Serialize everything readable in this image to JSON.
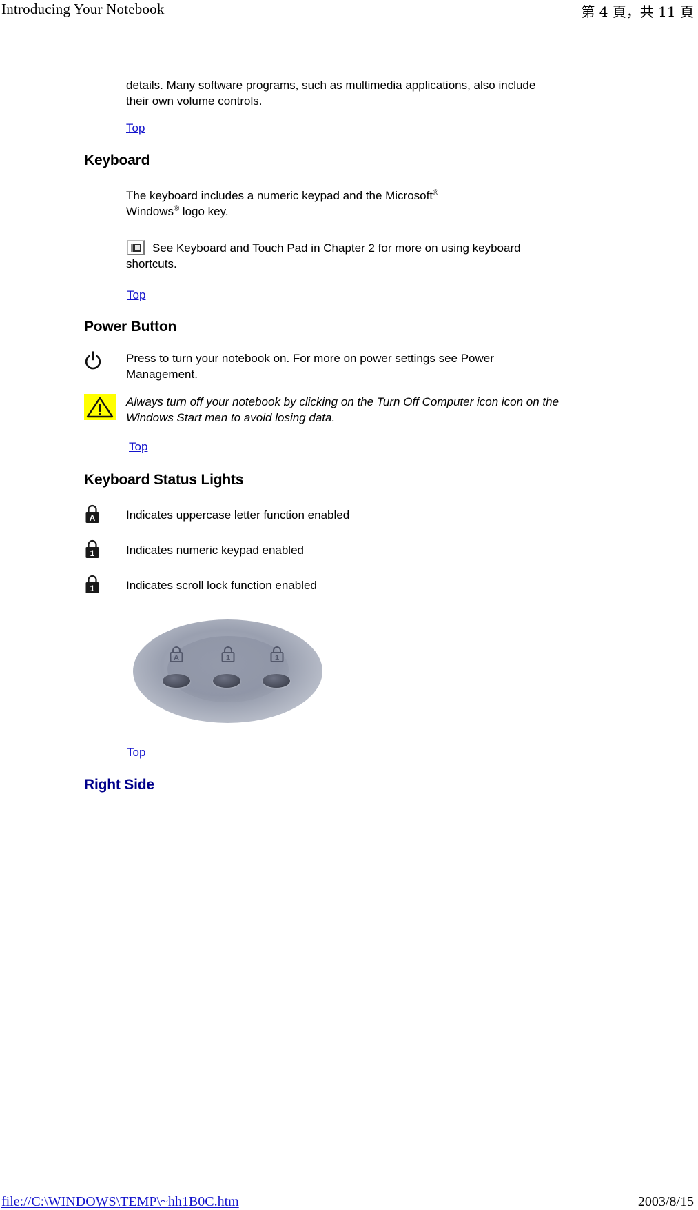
{
  "header": {
    "title": "Introducing Your Notebook",
    "page_indicator": "第 4 頁，共 11 頁"
  },
  "body": {
    "intro_paragraph": "details. Many software programs, such as multimedia applications, also include their own volume controls.",
    "top_link_1": "Top",
    "keyboard": {
      "heading": "Keyboard",
      "text_before_sup1": "The keyboard includes a numeric keypad and the Microsoft",
      "sup1": "®",
      "text_windows": " Windows",
      "sup2": "®",
      "text_after_sup2": "  logo key.",
      "note_text": "See Keyboard and Touch Pad in Chapter 2 for more on using keyboard shortcuts.",
      "note_icon": "note-book-icon",
      "top_link": "Top"
    },
    "power_button": {
      "heading": "Power Button",
      "icon": "power-icon",
      "text": "Press to turn your notebook on. For more on power settings see Power Management.",
      "caution_icon": "warning-triangle-icon",
      "caution_text": "Always turn off your notebook by clicking on the Turn Off Computer icon icon on the Windows Start men to avoid losing data.",
      "top_link": "Top"
    },
    "status_lights": {
      "heading": "Keyboard Status Lights",
      "items": [
        {
          "icon": "caps-lock-icon",
          "glyph": "A",
          "label": "Indicates uppercase letter function enabled"
        },
        {
          "icon": "num-lock-icon",
          "glyph": "1",
          "label": "Indicates numeric keypad enabled"
        },
        {
          "icon": "scroll-lock-icon",
          "glyph": "1",
          "label": "Indicates scroll lock function enabled"
        }
      ],
      "photo_alt": "keyboard-status-lights-photo",
      "photo_glyphs": [
        "A",
        "1",
        "1"
      ],
      "top_link": "Top"
    },
    "right_side": {
      "heading": "Right Side"
    }
  },
  "footer": {
    "path": "file://C:\\WINDOWS\\TEMP\\~hh1B0C.htm",
    "date": "2003/8/15"
  },
  "colors": {
    "link": "#1414CC",
    "heading_blue": "#00008B",
    "warning_bg": "#FFFF00"
  }
}
